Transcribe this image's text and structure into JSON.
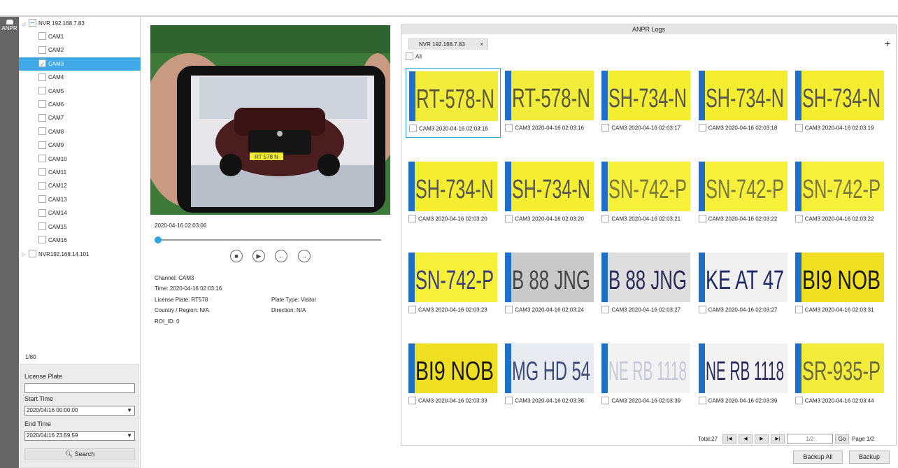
{
  "sidebar": {
    "anpr_label": "ANPR"
  },
  "tree": {
    "root": "NVR 192.168.7.83",
    "cams": [
      "CAM1",
      "CAM2",
      "CAM3",
      "CAM4",
      "CAM5",
      "CAM6",
      "CAM7",
      "CAM8",
      "CAM9",
      "CAM10",
      "CAM11",
      "CAM12",
      "CAM13",
      "CAM14",
      "CAM15",
      "CAM16"
    ],
    "selected": "CAM3",
    "second_root": "NVR192.168.14.101",
    "count": "1/80"
  },
  "search": {
    "plate_label": "License Plate",
    "plate_value": "",
    "start_label": "Start Time",
    "start_value": "2020/04/16 00:00:00",
    "end_label": "End Time",
    "end_value": "2020/04/16 23:59:59",
    "button": "Search"
  },
  "player": {
    "timestamp": "2020-04-16 02:03:06",
    "progress": 0.0,
    "plate_overlay": "RT 578 N"
  },
  "details": {
    "channel": "Channel: CAM3",
    "time": "Time: 2020-04-16 02:03:16",
    "plate": "License Plate: RT578",
    "plate_type": "Plate Type: Visitor",
    "region": "Country / Region: N/A",
    "direction": "Direction: N/A",
    "roi": "ROI_ID: 0"
  },
  "logs": {
    "title": "ANPR Logs",
    "tab": "NVR 192.168.7.83",
    "tab_close": "×",
    "add": "+",
    "all_label": "All",
    "items": [
      {
        "plate": "RT-578-N",
        "caption": "CAM3 2020-04-16 02:03:16",
        "bg": "#f2ec3a",
        "fg": "#5a5a3a"
      },
      {
        "plate": "RT-578-N",
        "caption": "CAM3 2020-04-16 02:03:16",
        "bg": "#f2ec3a",
        "fg": "#5a5a3a"
      },
      {
        "plate": "SH-734-N",
        "caption": "CAM3 2020-04-16 02:03:17",
        "bg": "#f5ee30",
        "fg": "#555"
      },
      {
        "plate": "SH-734-N",
        "caption": "CAM3 2020-04-16 02:03:18",
        "bg": "#f5ee30",
        "fg": "#555"
      },
      {
        "plate": "SH-734-N",
        "caption": "CAM3 2020-04-16 02:03:19",
        "bg": "#f5ee30",
        "fg": "#555"
      },
      {
        "plate": "SH-734-N",
        "caption": "CAM3 2020-04-16 02:03:20",
        "bg": "#f5ee30",
        "fg": "#555"
      },
      {
        "plate": "SH-734-N",
        "caption": "CAM3 2020-04-16 02:03:20",
        "bg": "#f5ee30",
        "fg": "#555"
      },
      {
        "plate": "SN-742-P",
        "caption": "CAM3 2020-04-16 02:03:21",
        "bg": "#f7f03a",
        "fg": "#7a7a40"
      },
      {
        "plate": "SN-742-P",
        "caption": "CAM3 2020-04-16 02:03:22",
        "bg": "#f7f03a",
        "fg": "#7a7a40"
      },
      {
        "plate": "SN-742-P",
        "caption": "CAM3 2020-04-16 02:03:22",
        "bg": "#f7f03a",
        "fg": "#7a7a40"
      },
      {
        "plate": "SN-742-P",
        "caption": "CAM3 2020-04-16 02:03:23",
        "bg": "#f7f03a",
        "fg": "#3c3c80"
      },
      {
        "plate": "B 88 JNG",
        "caption": "CAM3 2020-04-16 02:03:24",
        "bg": "#c9c9c9",
        "fg": "#444"
      },
      {
        "plate": "B 88 JNG",
        "caption": "CAM3 2020-04-16 02:03:27",
        "bg": "#dedede",
        "fg": "#2a2a5a"
      },
      {
        "plate": "KE AT 47",
        "caption": "CAM3 2020-04-16 02:03:27",
        "bg": "#f0f0f0",
        "fg": "#1e2a6a"
      },
      {
        "plate": "BI9 NOB",
        "caption": "CAM3 2020-04-16 02:03:31",
        "bg": "#f1e021",
        "fg": "#1a1a1a"
      },
      {
        "plate": "BI9 NOB",
        "caption": "CAM3 2020-04-16 02:03:33",
        "bg": "#f1e021",
        "fg": "#1a1a1a"
      },
      {
        "plate": "MG HD 54",
        "caption": "CAM3 2020-04-16 02:03:36",
        "bg": "#e8ecf1",
        "fg": "#3a4a7a"
      },
      {
        "plate": "NE RB 1118",
        "caption": "CAM3 2020-04-16 02:03:39",
        "bg": "#f2f2f2",
        "fg": "#c8c8d8"
      },
      {
        "plate": "NE RB 1118",
        "caption": "CAM3 2020-04-16 02:03:39",
        "bg": "#f2f2f2",
        "fg": "#2a2a5a"
      },
      {
        "plate": "SR-935-P",
        "caption": "CAM3 2020-04-16 02:03:44",
        "bg": "#f3ec3a",
        "fg": "#6a6a40"
      }
    ],
    "total": "Total:27",
    "page_input_placeholder": "1/2",
    "go": "Go",
    "page_label": "Page 1/2"
  },
  "footer": {
    "backup_all": "Backup All",
    "backup": "Backup"
  },
  "colors": {
    "accent": "#29a7e1",
    "selected_row": "#3fa8e6"
  }
}
